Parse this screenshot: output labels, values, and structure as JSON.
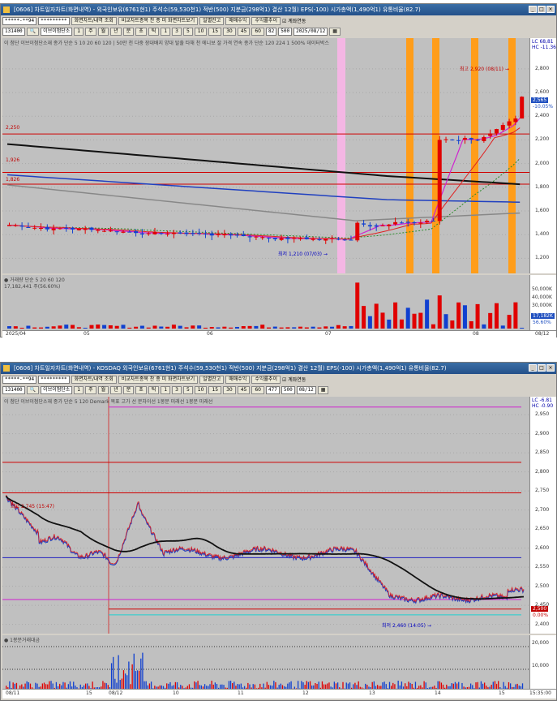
{
  "top": {
    "title": "[0606] 차트일자차트(화면내역) - 외국인보유(6761현1) 주석수(59,530천1) 적반(500) 지분금(298억1) 결산 12월) EPS(-100) 시가총액(1,490억1) 유통비율(82.7)",
    "toolbar": {
      "account": "*****-**94",
      "password": "*********",
      "btn_export": "화면차트/내역 조회",
      "btn_compare": "비교차트종목 찬 종 미 화면차트보기",
      "btn_daily": "일별잔고",
      "btn_trade": "매매수익",
      "btn_profit": "수익률추이",
      "chk_account": "계좌연동"
    },
    "toolbar2": {
      "code": "131400",
      "name": "이브이첨단소",
      "periods": [
        "1",
        "주",
        "월",
        "년",
        "분",
        "초",
        "틱",
        "1",
        "3",
        "5",
        "10",
        "15",
        "30",
        "45",
        "60",
        "1"
      ],
      "count": "82",
      "total": "500",
      "date": "2025/08/12"
    },
    "legend": "이 첨단 이브이첨단소재  종가 단순 5 10 20 60 120 | 50만 천 다중 장대배지 양대 탈출 타채 천 에니보 잘  가격 연속 종가 단순 120 224 1 500% 데이터박스",
    "hlabels": [
      {
        "text": "2,250",
        "color": "#c00000"
      },
      {
        "text": "1,926",
        "color": "#c00000"
      },
      {
        "text": "1,826",
        "color": "#c00000"
      }
    ],
    "annotations": {
      "high": "최고 2,920 (08/11) →",
      "low": "최저 1,210 (07/03) →"
    },
    "yticks": [
      "2,800",
      "2,600",
      "2,400",
      "2,200",
      "2,000",
      "1,800",
      "1,600",
      "1,400",
      "1,200"
    ],
    "corner": "LC 68,81\nHC -11.36",
    "price_tag": "2,565",
    "price_pct": "-10.05%",
    "volume_legend": "● 거래량 단순 5 20 60 120",
    "volume_value": "17,182,441 주(56.60%)",
    "vticks": [
      "50,000K",
      "40,000K",
      "30,000K"
    ],
    "vol_tag": "17,182K",
    "vol_pct": "56.60%",
    "xticks": [
      "2025/04",
      "05",
      "06",
      "07",
      "08"
    ],
    "date_label": "08/12"
  },
  "bottom": {
    "title": "[0606] 차트일자차트(화면내역) - KOSDAQ 외국인보유(6761현1) 주석수(59,530천1) 적반(500) 지분금(298억1) 결산 12월) EPS(-100) 시가총액(1,490억1) 유통비율(82.7)",
    "toolbar": {
      "account": "*****-**94",
      "password": "*********",
      "btn_export": "화면차트/내역 조회",
      "btn_compare": "비교차트종목 찬 종 미 화면차트보기",
      "btn_daily": "일별잔고",
      "btn_trade": "매매수익",
      "btn_profit": "수익률추이",
      "chk_account": "계좌연동"
    },
    "toolbar2": {
      "code": "131400",
      "name": "이브이첨단소",
      "count": "477",
      "total": "500",
      "date": "08/12"
    },
    "legend": "이 첨단 이브이첨단소재  종가 단순 5 120 Demark 목표 고가 선 분차이선 1봉분 미래선 1봉분 미래선",
    "annotations": {
      "high": "최고 2,745 (15:47)",
      "low": "최저 2,460 (14:05) →"
    },
    "yticks": [
      "2,950",
      "2,900",
      "2,850",
      "2,800",
      "2,750",
      "2,700",
      "2,650",
      "2,600",
      "2,550",
      "2,500",
      "2,450",
      "2,400"
    ],
    "corner": "LC -6.81\nHC -0.90",
    "price_tag": "2,500",
    "price_pct": "0.00%",
    "volume_legend": "● 1봉분거래대금",
    "vticks": [
      "20,000",
      "10,000"
    ],
    "xticks": [
      "08/11",
      "15",
      "08/12",
      "10",
      "11",
      "12",
      "13",
      "14",
      "15"
    ],
    "time_label": "15:35:00"
  },
  "chart_data": [
    {
      "type": "candlestick",
      "title": "131400 이브이첨단소재 일봉",
      "ylim": [
        1100,
        2950
      ],
      "x_range": [
        "2025/04",
        "2025/08/12"
      ],
      "high_marker": {
        "value": 2920,
        "date": "08/11"
      },
      "low_marker": {
        "value": 1210,
        "date": "07/03"
      },
      "hlines": [
        2250,
        1926,
        1826
      ],
      "last_close": 2565
    },
    {
      "type": "line",
      "title": "131400 이브이첨단소재 분봉",
      "ylim": [
        2380,
        2980
      ],
      "x_range": [
        "08/11",
        "08/12 15:35"
      ],
      "high_marker": {
        "value": 2745,
        "time": "15:47"
      },
      "low_marker": {
        "value": 2460,
        "time": "14:05"
      },
      "hlines": [
        2970,
        2825,
        2745,
        2575,
        2465,
        2440,
        2425
      ],
      "last_close": 2500
    }
  ]
}
